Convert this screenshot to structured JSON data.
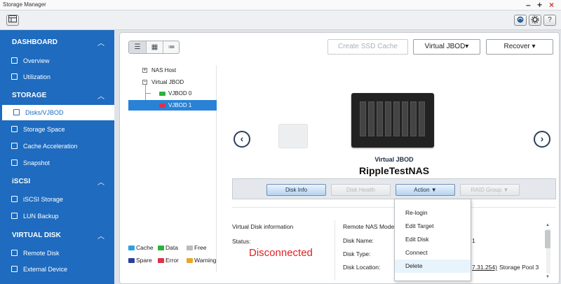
{
  "window": {
    "title": "Storage Manager",
    "controls": [
      "–",
      "+",
      "×"
    ]
  },
  "toolbar": {
    "left_icon": "panel-toggle-icon",
    "right_icons": [
      "qfinder-icon",
      "gear-icon",
      "help-icon"
    ],
    "help_label": "?"
  },
  "sidebar": {
    "sections": [
      {
        "label": "DASHBOARD",
        "items": [
          "Overview",
          "Utilization"
        ]
      },
      {
        "label": "STORAGE",
        "items": [
          "Disks/VJBOD",
          "Storage Space",
          "Cache Acceleration",
          "Snapshot"
        ]
      },
      {
        "label": "iSCSI",
        "items": [
          "iSCSI Storage",
          "LUN Backup"
        ]
      },
      {
        "label": "VIRTUAL DISK",
        "items": [
          "Remote Disk",
          "External Device"
        ]
      }
    ],
    "active_item": "Disks/VJBOD"
  },
  "top_buttons": {
    "create_ssd_cache": "Create SSD Cache",
    "virtual_jbod": "Virtual JBOD",
    "recover": "Recover"
  },
  "view_modes": [
    "list-view-icon",
    "grid-view-icon",
    "detail-view-icon"
  ],
  "tree": {
    "nas_host": "NAS Host",
    "virtual_jbod": "Virtual JBOD",
    "vjbod0": "VJBOD 0",
    "vjbod1": "VJBOD 1"
  },
  "legend": [
    {
      "label": "Cache",
      "color": "#2aa0e0"
    },
    {
      "label": "Data",
      "color": "#2bb33a"
    },
    {
      "label": "Free",
      "color": "#b8bcc0"
    },
    {
      "label": "Spare",
      "color": "#2b3f9c"
    },
    {
      "label": "Error",
      "color": "#e0304a"
    },
    {
      "label": "Warning",
      "color": "#e8a62a"
    }
  ],
  "device": {
    "type": "Virtual JBOD",
    "name": "RippleTestNAS"
  },
  "actions": {
    "disk_info": "Disk Info",
    "disk_health": "Disk Health",
    "action": "Action",
    "raid_group": "RAID Group"
  },
  "info": {
    "heading": "Virtual Disk information",
    "status_label": "Status:",
    "status_value": "Disconnected",
    "remote_model_label": "Remote NAS Model:",
    "disk_name_label": "Disk Name:",
    "disk_type_label": "Disk Type:",
    "disk_location_label": "Disk Location:",
    "disk_name_partial": "1",
    "location_link_partial": "7.31.254)",
    "location_suffix": "Storage Pool 3"
  },
  "action_menu": [
    "Re-login",
    "Edit Target",
    "Edit Disk",
    "Connect",
    "Delete"
  ],
  "colors": {
    "sidebar": "#1e6bbf",
    "selected": "#2a82d6",
    "error_text": "#e02020"
  }
}
